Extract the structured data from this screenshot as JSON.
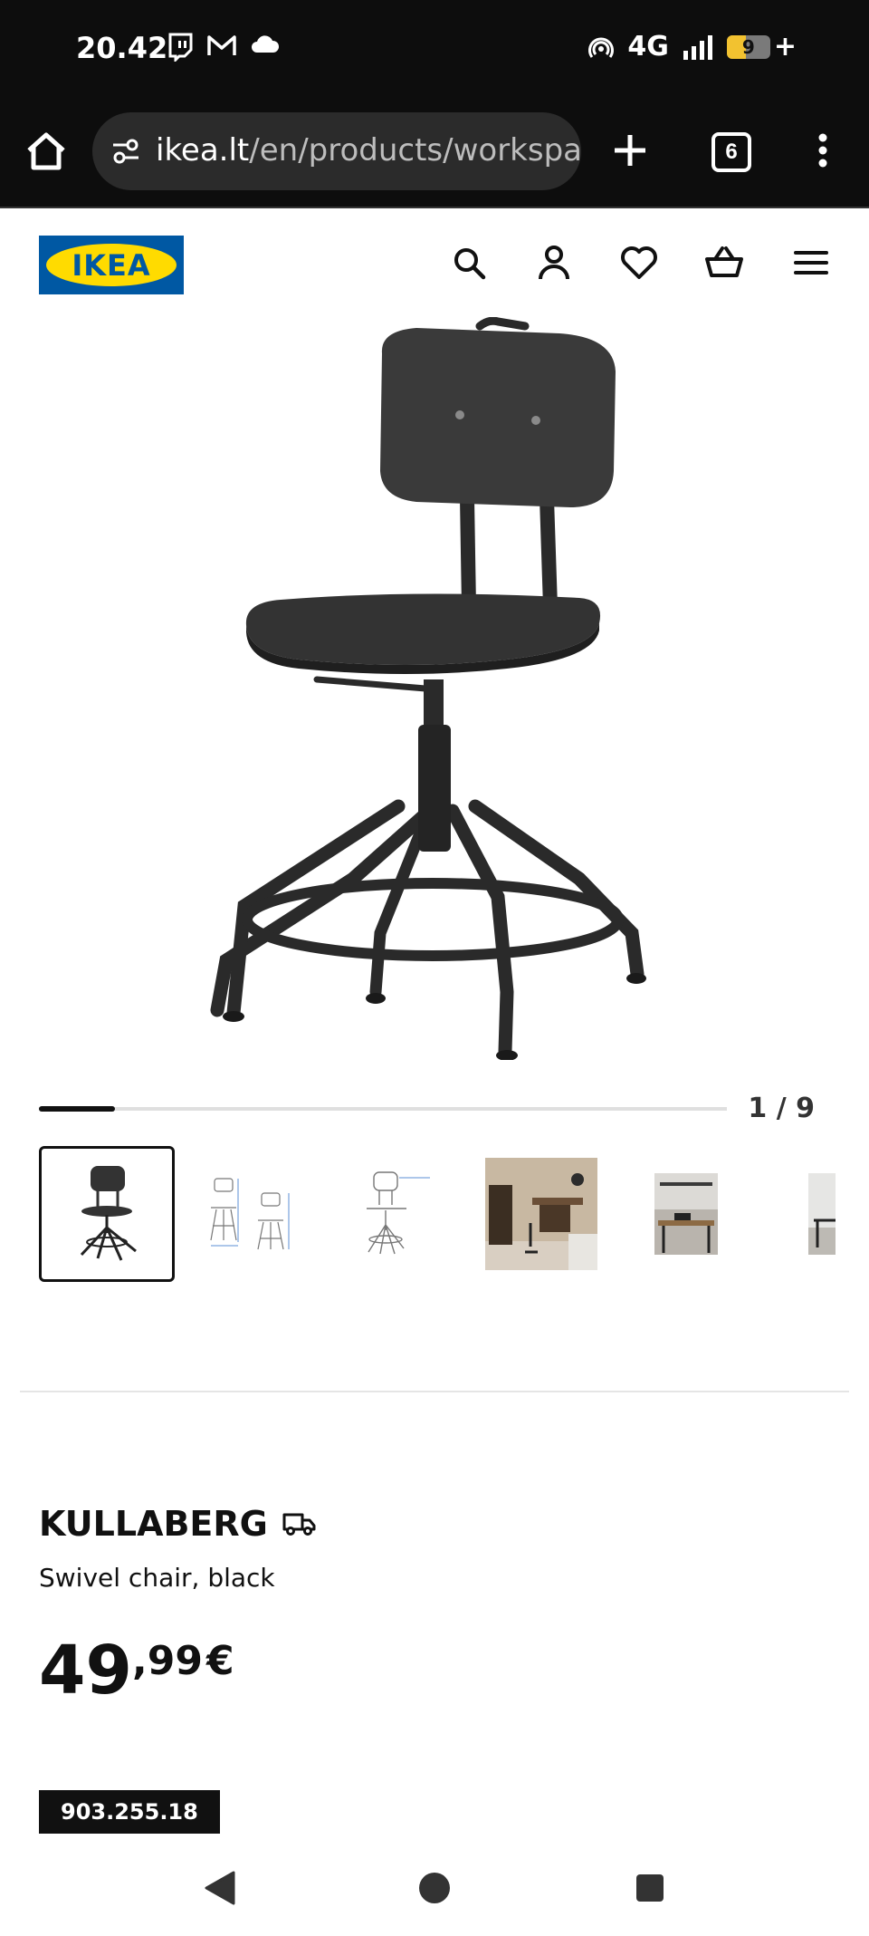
{
  "status_bar": {
    "time": "20.42",
    "network": "4G",
    "battery_level": "9",
    "battery_fraction": 0.45
  },
  "browser": {
    "url_host": "ikea.lt",
    "url_path": "/en/products/workspac",
    "tab_count": "6"
  },
  "header": {
    "logo_text": "IKEA"
  },
  "gallery": {
    "counter": "1 / 9",
    "current_index": 1,
    "total": 9,
    "progress_fraction": 0.11
  },
  "product": {
    "name": "KULLABERG",
    "description": "Swivel chair, black",
    "price_integer": "49",
    "price_decimal": ",99",
    "currency": "€",
    "article_number": "903.255.18"
  },
  "colors": {
    "ikea_blue": "#0058a3",
    "ikea_yellow": "#ffdb00",
    "chair": "#2a2a2a"
  }
}
